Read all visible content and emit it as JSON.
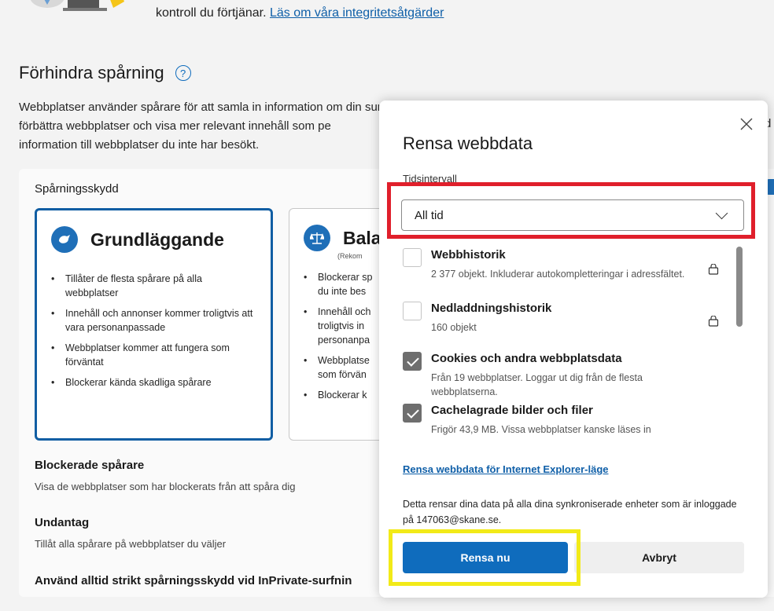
{
  "top_banner": {
    "text": "kontroll du förtjänar.",
    "link": "Läs om våra integritetsåtgärder"
  },
  "section": {
    "title": "Förhindra spårning",
    "help_icon": "question-circle-icon",
    "desc_line1": "Webbplatser använder spårare för att samla in information om din surfning. Webbplatser kan använda denna information i syfte",
    "desc_line2": "förbättra webbplatser och visa mer relevant innehåll som pe",
    "desc_line3": "information till webbplatser du inte har besökt."
  },
  "tracking": {
    "title": "Spårningsskydd",
    "basic": {
      "name": "Grundläggande",
      "icon": "shield-bird-icon",
      "bullets": [
        "Tillåter de flesta spårare på alla webbplatser",
        "Innehåll och annonser kommer troligtvis att vara personanpassade",
        "Webbplatser kommer att fungera som förväntat",
        "Blockerar kända skadliga spårare"
      ]
    },
    "balanced": {
      "name": "Bala",
      "sub": "(Rekom",
      "icon": "scales-icon",
      "bullets": [
        "Blockerar sp du inte bes",
        "Innehåll och troligtvis in personanpa",
        "Webbplatse som förvän",
        "Blockerar k"
      ]
    },
    "blocked_title": "Blockerade spårare",
    "blocked_sub": "Visa de webbplatser som har blockerats från att spåra dig",
    "exceptions_title": "Undantag",
    "exceptions_sub": "Tillåt alla spårare på webbplatser du väljer",
    "strict_title": "Använd alltid strikt spårningsskydd vid InPrivate-surfnin",
    "right_fragment": "d"
  },
  "dialog": {
    "title": "Rensa webbdata",
    "close_icon": "close-icon",
    "range_label": "Tidsintervall",
    "range_value": "All tid",
    "items": [
      {
        "title": "Webbhistorik",
        "desc": "2 377 objekt. Inkluderar autokompletteringar i adressfältet.",
        "checked": false,
        "lock": true
      },
      {
        "title": "Nedladdningshistorik",
        "desc": "160 objekt",
        "checked": false,
        "lock": true
      },
      {
        "title": "Cookies och andra webbplatsdata",
        "desc": "Från 19 webbplatser. Loggar ut dig från de flesta webbplatserna.",
        "checked": true,
        "lock": false
      },
      {
        "title": "Cachelagrade bilder och filer",
        "desc": "Frigör 43,9 MB. Vissa webbplatser kanske läses in",
        "checked": true,
        "lock": false
      }
    ],
    "ie_link": "Rensa webbdata för Internet Explorer-läge",
    "sync_note": "Detta rensar dina data på alla dina synkroniserade enheter som är inloggade på 147063@skane.se.",
    "primary_button": "Rensa nu",
    "secondary_button": "Avbryt"
  },
  "colors": {
    "accent": "#0f6cbd",
    "highlight_red": "#e01f2b",
    "highlight_yellow": "#f2ea18"
  }
}
